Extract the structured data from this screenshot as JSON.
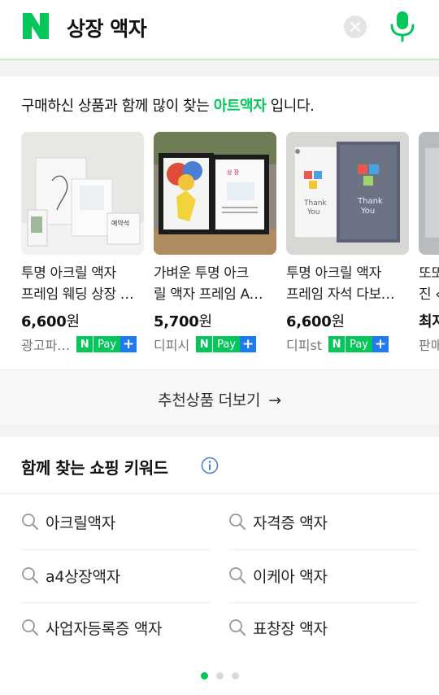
{
  "header": {
    "query": "상장 액자",
    "brand_color": "#03c75a"
  },
  "recommend": {
    "title_prefix": "구매하신 상품과 함께 많이 찾는 ",
    "title_keyword": "아트액자",
    "title_suffix": " 입니다.",
    "products": [
      {
        "name_line1": "투명 아크릴 액자",
        "name_line2": "프레임 웨딩 상장 …",
        "price": "6,600",
        "currency": "원",
        "seller": "광고파…",
        "npay": true
      },
      {
        "name_line1": "가벼운 투명 아크",
        "name_line2": "릴 액자 프레임 A…",
        "price": "5,700",
        "currency": "원",
        "seller": "디피시",
        "npay": true
      },
      {
        "name_line1": "투명 아크릴 액자",
        "name_line2": "프레임 자석 다보…",
        "price": "6,600",
        "currency": "원",
        "seller": "디피st",
        "npay": true
      },
      {
        "name_line1": "또또",
        "name_line2": "진 ‹",
        "price": "최저",
        "currency": "",
        "seller": "판매",
        "npay": false
      }
    ],
    "npay_labels": {
      "n": "N",
      "pay": "Pay",
      "plus": "+"
    },
    "more_label": "추천상품 더보기",
    "more_arrow": "→"
  },
  "keywords": {
    "title": "함께 찾는 쇼핑 키워드",
    "items": [
      "아크릴액자",
      "자격증 액자",
      "a4상장액자",
      "이케아 액자",
      "사업자등록증 액자",
      "표창장 액자"
    ],
    "page_count": 3,
    "active_page": 1
  }
}
